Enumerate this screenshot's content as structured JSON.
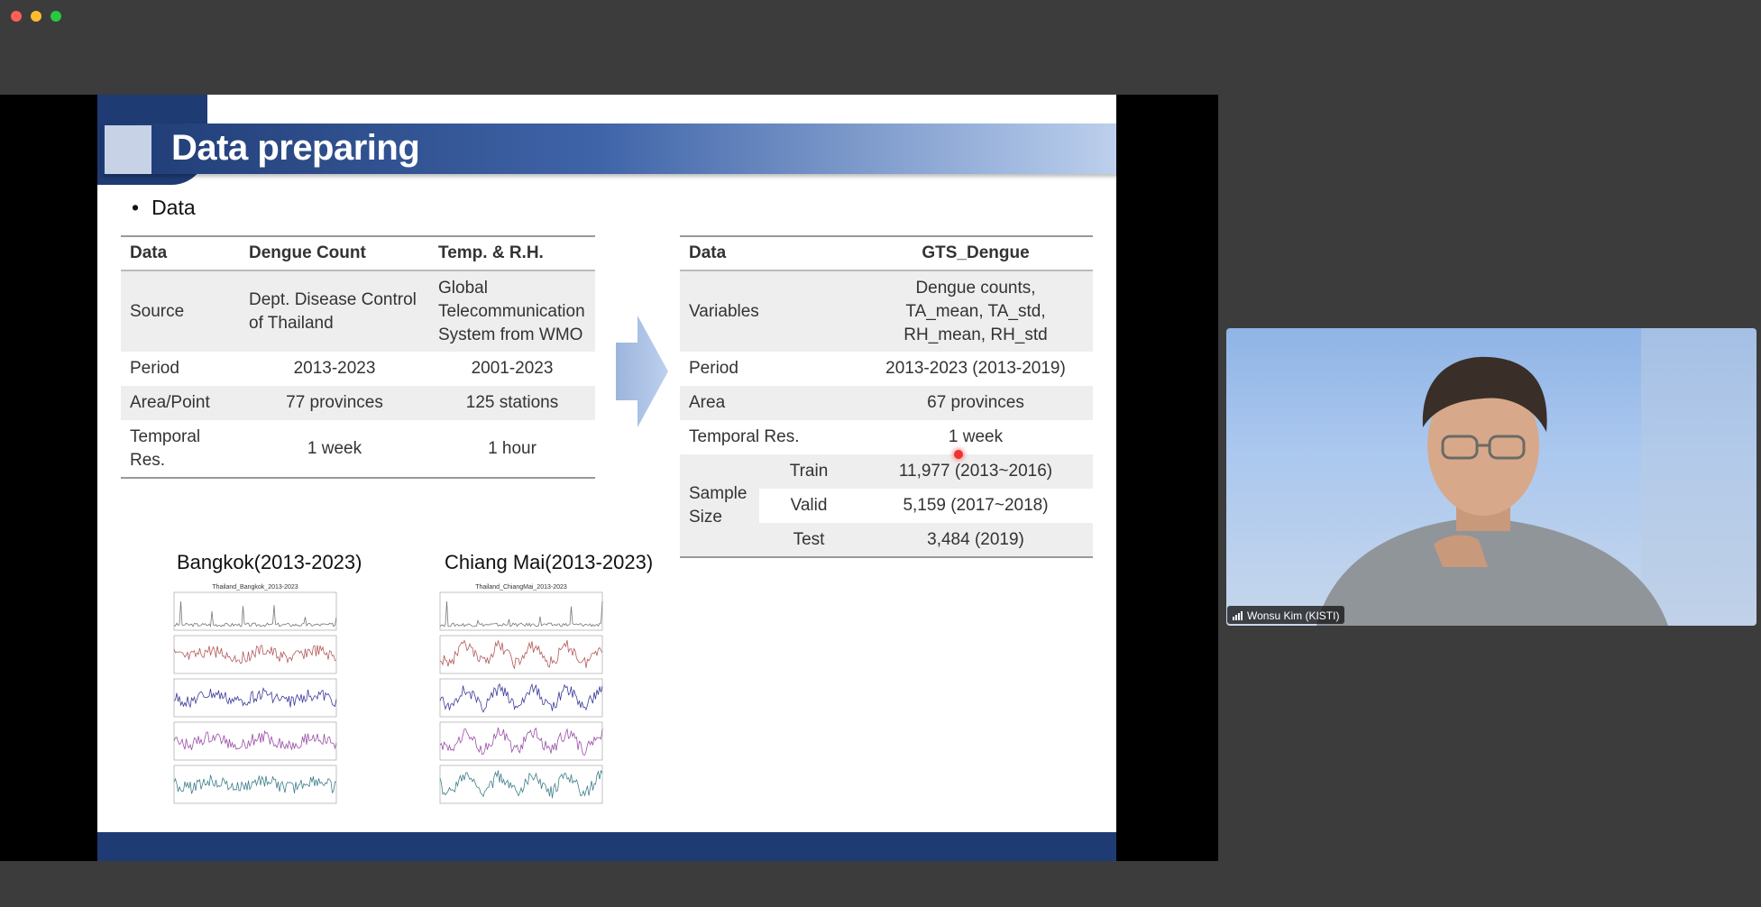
{
  "slide": {
    "title": "Data preparing",
    "bullet": "Data",
    "table1": {
      "headers": [
        "Data",
        "Dengue Count",
        "Temp. & R.H."
      ],
      "rows": [
        {
          "label": "Source",
          "dengue": "Dept. Disease Control of Thailand",
          "temp": "Global Telecommunication System from WMO"
        },
        {
          "label": "Period",
          "dengue": "2013-2023",
          "temp": "2001-2023"
        },
        {
          "label": "Area/Point",
          "dengue": "77 provinces",
          "temp": "125 stations"
        },
        {
          "label": "Temporal Res.",
          "dengue": "1 week",
          "temp": "1 hour"
        }
      ]
    },
    "table2": {
      "headers": [
        "Data",
        "GTS_Dengue"
      ],
      "rows": [
        {
          "label": "Variables",
          "value": "Dengue counts, TA_mean, TA_std, RH_mean, RH_std"
        },
        {
          "label": "Period",
          "value": "2013-2023 (2013-2019)"
        },
        {
          "label": "Area",
          "value": "67 provinces"
        },
        {
          "label": "Temporal Res.",
          "value": "1 week"
        }
      ],
      "sample": {
        "label": "Sample Size",
        "items": [
          {
            "split": "Train",
            "value": "11,977 (2013~2016)"
          },
          {
            "split": "Valid",
            "value": "5,159 (2017~2018)"
          },
          {
            "split": "Test",
            "value": "3,484 (2019)"
          }
        ]
      }
    },
    "charts": [
      {
        "caption": "Bangkok(2013-2023)",
        "inner_title": "Thailand_Bangkok_2013-2023"
      },
      {
        "caption": "Chiang Mai(2013-2023)",
        "inner_title": "Thailand_ChiangMai_2013-2023"
      }
    ]
  },
  "participant": {
    "name": "Wonsu Kim (KISTI)"
  },
  "colors": {
    "slide_navy": "#1f3b73",
    "share_bg": "#000000",
    "app_bg": "#3c3c3c"
  }
}
